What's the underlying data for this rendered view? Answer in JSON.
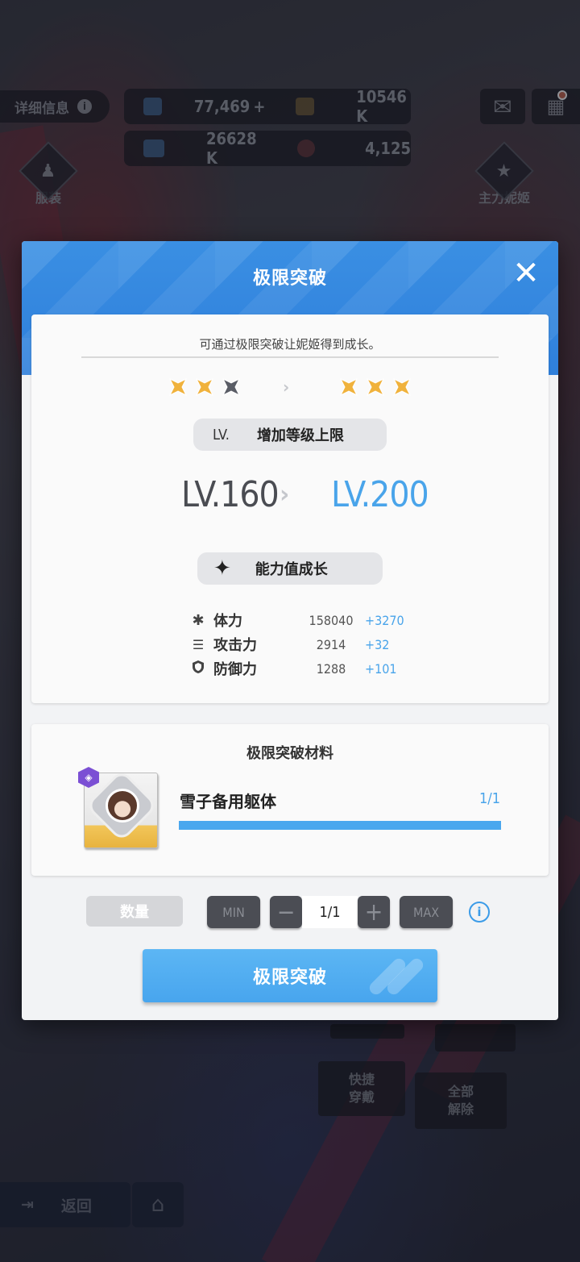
{
  "background": {
    "detail_label": "详细信息",
    "resources": [
      {
        "icon": "gem-icon",
        "value": "77,469",
        "plus": "+"
      },
      {
        "icon": "credit-card-icon",
        "value": "10546 K"
      },
      {
        "icon": "battle-data-icon",
        "value": "26628 K"
      },
      {
        "icon": "core-dust-icon",
        "value": "4,125"
      }
    ],
    "side_left_label": "服装",
    "side_right_label": "主力妮姬",
    "quick_equip_label": "快捷\n穿戴",
    "unequip_all_label": "全部\n解除",
    "back_label": "返回"
  },
  "modal": {
    "title": "极限突破",
    "hint": "可通过极限突破让妮姬得到成长。",
    "stars_before": [
      "filled",
      "filled",
      "empty"
    ],
    "stars_after": [
      "filled",
      "filled",
      "filled"
    ],
    "colors": {
      "star_filled": "#f0b23c",
      "star_empty": "#5a5d66",
      "accent": "#49a4ea"
    },
    "level_tag": "LV.",
    "level_label": "增加等级上限",
    "level_old": "LV.160",
    "level_new": "LV.200",
    "growth_label": "能力值成长",
    "stats": [
      {
        "icon": "hp-asterisk-icon",
        "name": "体力",
        "value": "158040",
        "plus": "+3270"
      },
      {
        "icon": "attack-bullets-icon",
        "name": "攻击力",
        "value": "2914",
        "plus": "+32"
      },
      {
        "icon": "shield-icon",
        "name": "防御力",
        "value": "1288",
        "plus": "+101"
      }
    ],
    "material": {
      "title": "极限突破材料",
      "name": "雪子备用躯体",
      "count": "1/1",
      "progress": 1.0
    },
    "quantity": {
      "label": "数量",
      "min": "MIN",
      "value": "1/1",
      "max": "MAX"
    },
    "confirm_label": "极限突破"
  }
}
